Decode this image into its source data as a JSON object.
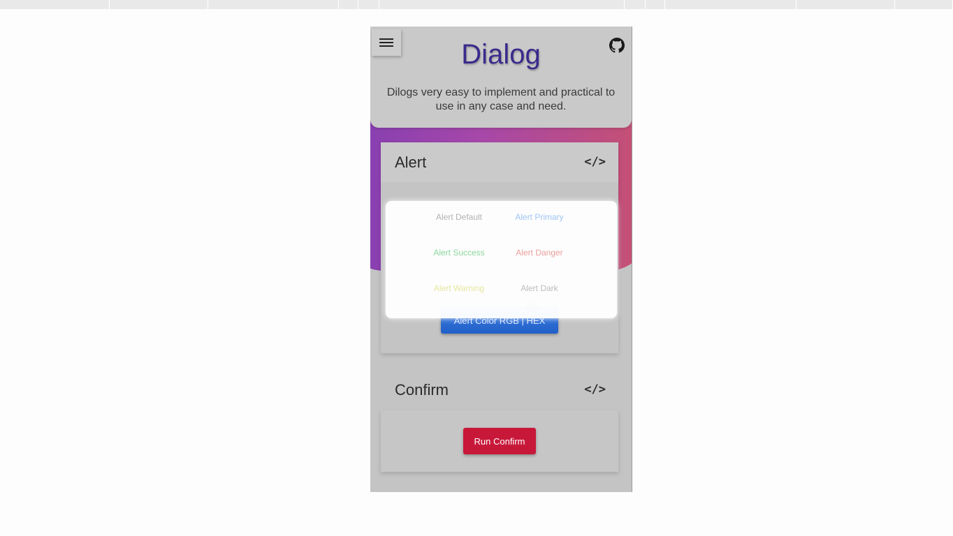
{
  "header": {
    "title": "Dialog",
    "subtitle": "Dilogs very easy to implement and practical to use in any case and need."
  },
  "alert_section": {
    "title": "Alert",
    "code_icon": "</>",
    "color_button_label": "Alert Color RGB | HEX"
  },
  "alert_options": {
    "default_label": "Alert Default",
    "primary_label": "Alert Primary",
    "success_label": "Alert Success",
    "danger_label": "Alert Danger",
    "warning_label": "Alert Warning",
    "dark_label": "Alert Dark"
  },
  "confirm_section": {
    "title": "Confirm",
    "code_icon": "</>",
    "run_button_label": "Run Confirm"
  },
  "icons": {
    "menu": "hamburger-menu-icon",
    "github": "github-icon",
    "code": "code-icon"
  },
  "colors": {
    "title": "#3a2a8c",
    "primary_button": "#1f5fc8",
    "confirm_button": "#c8183a",
    "gradient_start": "#7a2fb0",
    "gradient_end": "#c94466"
  }
}
